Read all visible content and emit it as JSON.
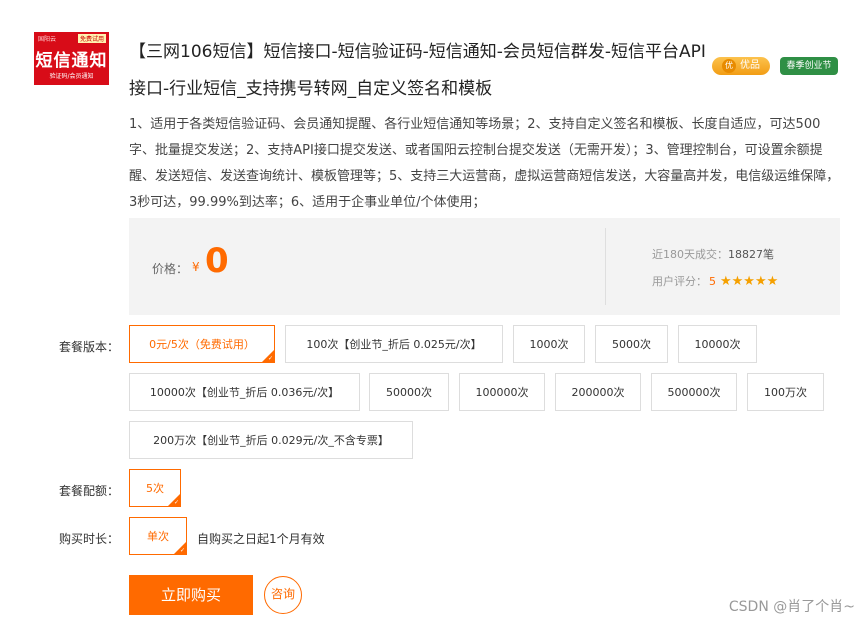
{
  "product": {
    "thumb": {
      "top": "国阳云",
      "free": "免费试用",
      "big": "短信通知",
      "small": "验证码/会员通知"
    },
    "title": "【三网106短信】短信接口-短信验证码-短信通知-会员短信群发-短信平台API接口-行业短信_支持携号转网_自定义签名和模板",
    "badges": {
      "quality_icon": "优",
      "quality": "优品",
      "season": "春季创业节"
    },
    "description": "1、适用于各类短信验证码、会员通知提醒、各行业短信通知等场景；2、支持自定义签名和模板、长度自适应，可达500字、批量提交发送；2、支持API接口提交发送、或者国阳云控制台提交发送（无需开发）；3、管理控制台，可设置余额提醒、发送短信、发送查询统计、模板管理等；5、支持三大运营商，虚拟运营商短信发送，大容量高并发，电信级运维保障，3秒可达，99.99%到达率；6、适用于企事业单位/个体使用；"
  },
  "price": {
    "label": "价格：",
    "symbol": "¥",
    "value": "0",
    "sold_label": "近180天成交：",
    "sold_value": "18827笔",
    "rating_label": "用户评分：",
    "rating_value": "5",
    "stars": "★★★★★"
  },
  "packages": {
    "label": "套餐版本：",
    "selected": "0元/5次（免费试用）",
    "options": [
      "0元/5次（免费试用）",
      "100次【创业节_折后 0.025元/次】",
      "1000次",
      "5000次",
      "10000次",
      "10000次【创业节_折后 0.036元/次】",
      "50000次",
      "100000次",
      "200000次",
      "500000次",
      "100万次",
      "200万次【创业节_折后 0.029元/次_不含专票】"
    ]
  },
  "quota": {
    "label": "套餐配额：",
    "value": "5次"
  },
  "duration": {
    "label": "购买时长：",
    "value": "单次",
    "note": "自购买之日起1个月有效"
  },
  "actions": {
    "buy": "立即购买",
    "consult": "咨询"
  },
  "watermark": "CSDN @肖了个肖~",
  "colors": {
    "accent": "#ff6a00",
    "thumb_bg": "#d80c18"
  }
}
